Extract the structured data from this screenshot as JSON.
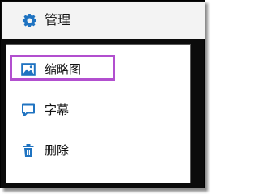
{
  "header": {
    "title": "管理",
    "icon": "gear-icon",
    "icon_color": "#1f73c1",
    "background": "#f3f3f3"
  },
  "menu": {
    "items": [
      {
        "label": "缩略图",
        "icon": "thumbnail-image-icon",
        "highlighted": true
      },
      {
        "label": "字幕",
        "icon": "caption-icon",
        "highlighted": false
      },
      {
        "label": "删除",
        "icon": "trash-icon",
        "highlighted": false
      }
    ],
    "highlight_color": "#b24fcf",
    "icon_color": "#1f73c1"
  }
}
